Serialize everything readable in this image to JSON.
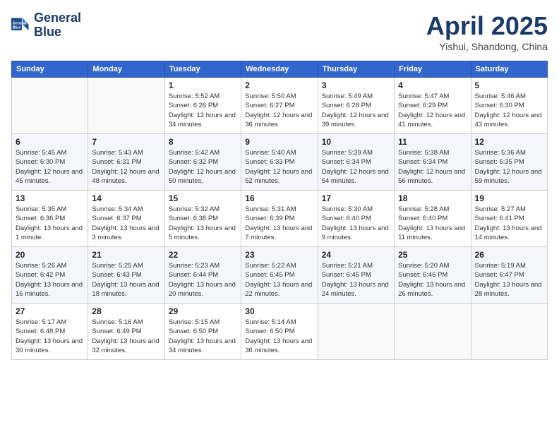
{
  "header": {
    "logo_line1": "General",
    "logo_line2": "Blue",
    "month": "April 2025",
    "location": "Yishui, Shandong, China"
  },
  "weekdays": [
    "Sunday",
    "Monday",
    "Tuesday",
    "Wednesday",
    "Thursday",
    "Friday",
    "Saturday"
  ],
  "weeks": [
    [
      {
        "day": "",
        "sunrise": "",
        "sunset": "",
        "daylight": ""
      },
      {
        "day": "",
        "sunrise": "",
        "sunset": "",
        "daylight": ""
      },
      {
        "day": "1",
        "sunrise": "Sunrise: 5:52 AM",
        "sunset": "Sunset: 6:26 PM",
        "daylight": "Daylight: 12 hours and 34 minutes."
      },
      {
        "day": "2",
        "sunrise": "Sunrise: 5:50 AM",
        "sunset": "Sunset: 6:27 PM",
        "daylight": "Daylight: 12 hours and 36 minutes."
      },
      {
        "day": "3",
        "sunrise": "Sunrise: 5:49 AM",
        "sunset": "Sunset: 6:28 PM",
        "daylight": "Daylight: 12 hours and 39 minutes."
      },
      {
        "day": "4",
        "sunrise": "Sunrise: 5:47 AM",
        "sunset": "Sunset: 6:29 PM",
        "daylight": "Daylight: 12 hours and 41 minutes."
      },
      {
        "day": "5",
        "sunrise": "Sunrise: 5:46 AM",
        "sunset": "Sunset: 6:30 PM",
        "daylight": "Daylight: 12 hours and 43 minutes."
      }
    ],
    [
      {
        "day": "6",
        "sunrise": "Sunrise: 5:45 AM",
        "sunset": "Sunset: 6:30 PM",
        "daylight": "Daylight: 12 hours and 45 minutes."
      },
      {
        "day": "7",
        "sunrise": "Sunrise: 5:43 AM",
        "sunset": "Sunset: 6:31 PM",
        "daylight": "Daylight: 12 hours and 48 minutes."
      },
      {
        "day": "8",
        "sunrise": "Sunrise: 5:42 AM",
        "sunset": "Sunset: 6:32 PM",
        "daylight": "Daylight: 12 hours and 50 minutes."
      },
      {
        "day": "9",
        "sunrise": "Sunrise: 5:40 AM",
        "sunset": "Sunset: 6:33 PM",
        "daylight": "Daylight: 12 hours and 52 minutes."
      },
      {
        "day": "10",
        "sunrise": "Sunrise: 5:39 AM",
        "sunset": "Sunset: 6:34 PM",
        "daylight": "Daylight: 12 hours and 54 minutes."
      },
      {
        "day": "11",
        "sunrise": "Sunrise: 5:38 AM",
        "sunset": "Sunset: 6:34 PM",
        "daylight": "Daylight: 12 hours and 56 minutes."
      },
      {
        "day": "12",
        "sunrise": "Sunrise: 5:36 AM",
        "sunset": "Sunset: 6:35 PM",
        "daylight": "Daylight: 12 hours and 59 minutes."
      }
    ],
    [
      {
        "day": "13",
        "sunrise": "Sunrise: 5:35 AM",
        "sunset": "Sunset: 6:36 PM",
        "daylight": "Daylight: 13 hours and 1 minute."
      },
      {
        "day": "14",
        "sunrise": "Sunrise: 5:34 AM",
        "sunset": "Sunset: 6:37 PM",
        "daylight": "Daylight: 13 hours and 3 minutes."
      },
      {
        "day": "15",
        "sunrise": "Sunrise: 5:32 AM",
        "sunset": "Sunset: 6:38 PM",
        "daylight": "Daylight: 13 hours and 5 minutes."
      },
      {
        "day": "16",
        "sunrise": "Sunrise: 5:31 AM",
        "sunset": "Sunset: 6:39 PM",
        "daylight": "Daylight: 13 hours and 7 minutes."
      },
      {
        "day": "17",
        "sunrise": "Sunrise: 5:30 AM",
        "sunset": "Sunset: 6:40 PM",
        "daylight": "Daylight: 13 hours and 9 minutes."
      },
      {
        "day": "18",
        "sunrise": "Sunrise: 5:28 AM",
        "sunset": "Sunset: 6:40 PM",
        "daylight": "Daylight: 13 hours and 11 minutes."
      },
      {
        "day": "19",
        "sunrise": "Sunrise: 5:27 AM",
        "sunset": "Sunset: 6:41 PM",
        "daylight": "Daylight: 13 hours and 14 minutes."
      }
    ],
    [
      {
        "day": "20",
        "sunrise": "Sunrise: 5:26 AM",
        "sunset": "Sunset: 6:42 PM",
        "daylight": "Daylight: 13 hours and 16 minutes."
      },
      {
        "day": "21",
        "sunrise": "Sunrise: 5:25 AM",
        "sunset": "Sunset: 6:43 PM",
        "daylight": "Daylight: 13 hours and 18 minutes."
      },
      {
        "day": "22",
        "sunrise": "Sunrise: 5:23 AM",
        "sunset": "Sunset: 6:44 PM",
        "daylight": "Daylight: 13 hours and 20 minutes."
      },
      {
        "day": "23",
        "sunrise": "Sunrise: 5:22 AM",
        "sunset": "Sunset: 6:45 PM",
        "daylight": "Daylight: 13 hours and 22 minutes."
      },
      {
        "day": "24",
        "sunrise": "Sunrise: 5:21 AM",
        "sunset": "Sunset: 6:45 PM",
        "daylight": "Daylight: 13 hours and 24 minutes."
      },
      {
        "day": "25",
        "sunrise": "Sunrise: 5:20 AM",
        "sunset": "Sunset: 6:46 PM",
        "daylight": "Daylight: 13 hours and 26 minutes."
      },
      {
        "day": "26",
        "sunrise": "Sunrise: 5:19 AM",
        "sunset": "Sunset: 6:47 PM",
        "daylight": "Daylight: 13 hours and 28 minutes."
      }
    ],
    [
      {
        "day": "27",
        "sunrise": "Sunrise: 5:17 AM",
        "sunset": "Sunset: 6:48 PM",
        "daylight": "Daylight: 13 hours and 30 minutes."
      },
      {
        "day": "28",
        "sunrise": "Sunrise: 5:16 AM",
        "sunset": "Sunset: 6:49 PM",
        "daylight": "Daylight: 13 hours and 32 minutes."
      },
      {
        "day": "29",
        "sunrise": "Sunrise: 5:15 AM",
        "sunset": "Sunset: 6:50 PM",
        "daylight": "Daylight: 13 hours and 34 minutes."
      },
      {
        "day": "30",
        "sunrise": "Sunrise: 5:14 AM",
        "sunset": "Sunset: 6:50 PM",
        "daylight": "Daylight: 13 hours and 36 minutes."
      },
      {
        "day": "",
        "sunrise": "",
        "sunset": "",
        "daylight": ""
      },
      {
        "day": "",
        "sunrise": "",
        "sunset": "",
        "daylight": ""
      },
      {
        "day": "",
        "sunrise": "",
        "sunset": "",
        "daylight": ""
      }
    ]
  ]
}
